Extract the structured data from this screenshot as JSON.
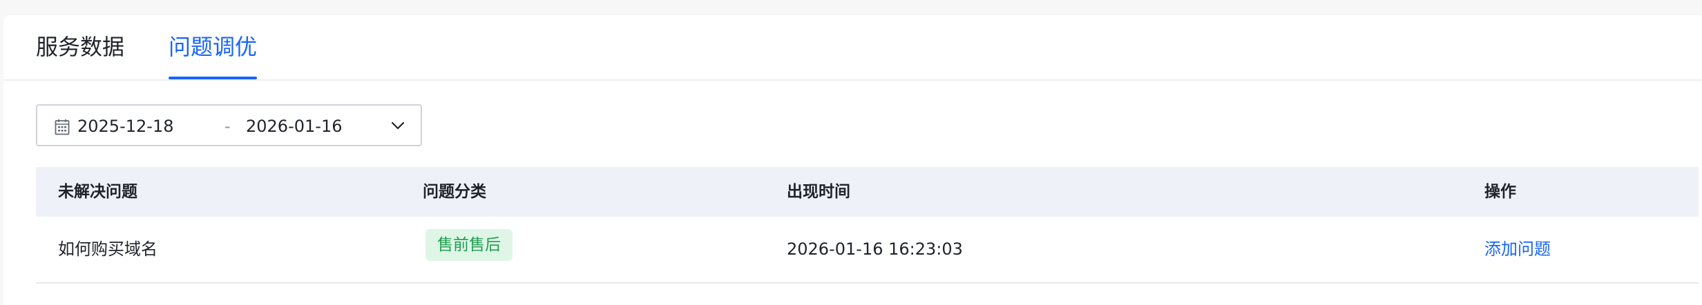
{
  "tabs": [
    {
      "label": "服务数据",
      "active": false
    },
    {
      "label": "问题调优",
      "active": true
    }
  ],
  "date_range": {
    "start": "2025-12-18",
    "separator": "-",
    "end": "2026-01-16",
    "icon": "calendar-icon",
    "dropdown_icon": "chevron-down-icon"
  },
  "table": {
    "columns": [
      "未解决问题",
      "问题分类",
      "出现时间",
      "操作"
    ],
    "rows": [
      {
        "question": "如何购买域名",
        "category": "售前售后",
        "time": "2026-01-16 16:23:03",
        "action": "添加问题"
      }
    ]
  },
  "colors": {
    "accent": "#1664ff",
    "tag_background": "#dff6e7",
    "tag_text": "#1e9e4f",
    "header_background": "#eef2f8"
  }
}
